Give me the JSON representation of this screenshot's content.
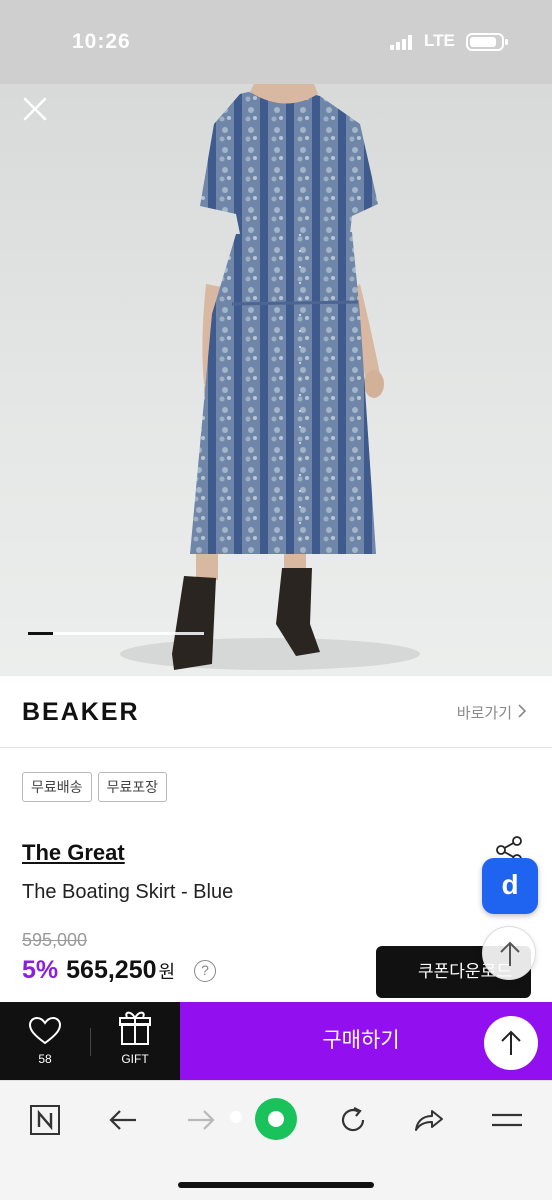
{
  "status_bar": {
    "time": "10:26",
    "network": "LTE",
    "battery_level": 0.85
  },
  "hero": {
    "image_index": 1,
    "image_progress": 0.14
  },
  "brand": {
    "logo": "BEAKER",
    "shortcut_label": "바로가기"
  },
  "tags": [
    "무료배송",
    "무료포장"
  ],
  "product": {
    "brand": "The Great",
    "name": "The Boating Skirt - Blue",
    "original_price": "595,000",
    "discount": "5%",
    "sale_price": "565,250",
    "currency": "원"
  },
  "floating": {
    "app_badge": "d",
    "coupon_label": "쿠폰다운로드"
  },
  "purchase_bar": {
    "like_count": "58",
    "gift_label": "GIFT",
    "buy_label": "구매하기"
  },
  "browser_toolbar": {
    "icons": [
      "naver-home-icon",
      "back-arrow-icon",
      "forward-arrow-icon",
      "green-dot-icon",
      "reload-icon",
      "share-arrow-icon",
      "menu-icon"
    ]
  },
  "colors": {
    "accent_purple": "#9210f0",
    "discount_purple": "#8a1fe0",
    "app_blue": "#1f64f0",
    "browser_green": "#19c25a"
  }
}
